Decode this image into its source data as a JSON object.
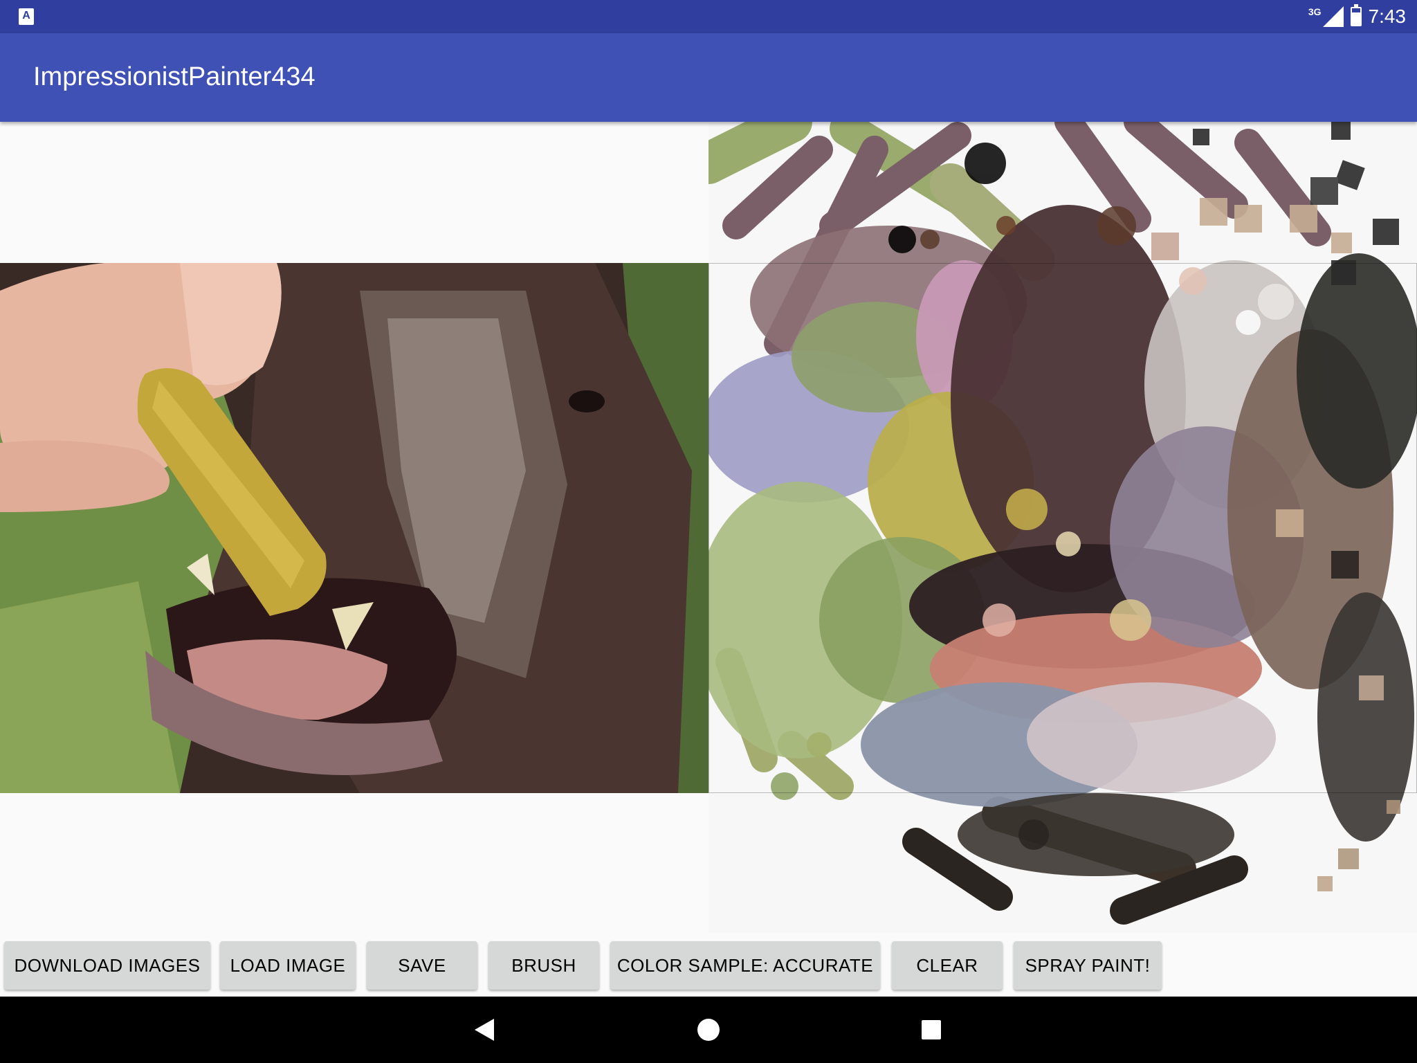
{
  "status_bar": {
    "app_icon": "A",
    "network_label": "3G",
    "time": "7:43",
    "icons": [
      "app-notification-icon",
      "signal-icon",
      "battery-icon"
    ]
  },
  "app_bar": {
    "title": "ImpressionistPainter434"
  },
  "source_image": {
    "description_icon": "photo-of-dog-eating-treat"
  },
  "painting": {
    "description_icon": "impressionist-painting-canvas"
  },
  "buttons": [
    {
      "id": "download",
      "label": "DOWNLOAD IMAGES"
    },
    {
      "id": "load",
      "label": "LOAD IMAGE"
    },
    {
      "id": "save",
      "label": "SAVE"
    },
    {
      "id": "brush",
      "label": "BRUSH"
    },
    {
      "id": "color_sample",
      "label": "COLOR SAMPLE: ACCURATE"
    },
    {
      "id": "clear",
      "label": "CLEAR"
    },
    {
      "id": "spray",
      "label": "SPRAY PAINT!"
    }
  ],
  "nav_bar": {
    "icons": [
      "back-icon",
      "home-icon",
      "recents-icon"
    ]
  }
}
